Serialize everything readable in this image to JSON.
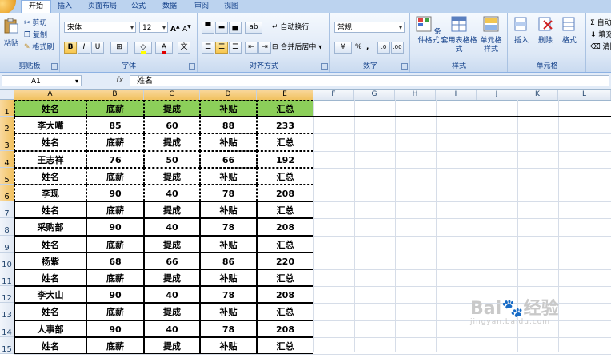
{
  "ribbon": {
    "tabs": [
      "开始",
      "插入",
      "页面布局",
      "公式",
      "数据",
      "审阅",
      "视图"
    ],
    "active_tab": "开始",
    "clipboard": {
      "paste": "粘贴",
      "cut": "剪切",
      "copy": "复制",
      "format_painter": "格式刷",
      "label": "剪贴板"
    },
    "font": {
      "name": "宋体",
      "size": "12",
      "bold": "B",
      "italic": "I",
      "underline": "U",
      "color_glyph": "A",
      "label": "字体"
    },
    "alignment": {
      "wrap": "自动换行",
      "merge": "合并后居中",
      "label": "对齐方式"
    },
    "number": {
      "format": "常规",
      "percent": "%",
      "comma": ",",
      "label": "数字"
    },
    "styles": {
      "conditional": "条件格式",
      "table_format": "套用表格格式",
      "cell_styles": "单元格样式",
      "label": "样式"
    },
    "cells": {
      "insert": "插入",
      "delete": "删除",
      "format": "格式",
      "label": "单元格"
    },
    "editing": {
      "autosum": "自动",
      "fill": "填充",
      "clear": "清除"
    },
    "colors": {
      "accent": "#15428b",
      "bold_active": "#f7c64d"
    }
  },
  "formula_bar": {
    "name_box": "A1",
    "fx": "fx",
    "content": "姓名"
  },
  "columns": [
    "A",
    "B",
    "C",
    "D",
    "E",
    "F",
    "G",
    "H",
    "I",
    "J",
    "K",
    "L"
  ],
  "rows": [
    {
      "num": "1",
      "cells": [
        "姓名",
        "底薪",
        "提成",
        "补贴",
        "汇总"
      ],
      "header": true
    },
    {
      "num": "2",
      "cells": [
        "李大嘴",
        "85",
        "60",
        "88",
        "233"
      ]
    },
    {
      "num": "3",
      "cells": [
        "姓名",
        "底薪",
        "提成",
        "补贴",
        "汇总"
      ]
    },
    {
      "num": "4",
      "cells": [
        "王志祥",
        "76",
        "50",
        "66",
        "192"
      ]
    },
    {
      "num": "5",
      "cells": [
        "姓名",
        "底薪",
        "提成",
        "补贴",
        "汇总"
      ]
    },
    {
      "num": "6",
      "cells": [
        "李现",
        "90",
        "40",
        "78",
        "208"
      ]
    },
    {
      "num": "7",
      "cells": [
        "姓名",
        "底薪",
        "提成",
        "补贴",
        "汇总"
      ]
    },
    {
      "num": "8",
      "cells": [
        "采购部",
        "90",
        "40",
        "78",
        "208"
      ]
    },
    {
      "num": "9",
      "cells": [
        "姓名",
        "底薪",
        "提成",
        "补贴",
        "汇总"
      ]
    },
    {
      "num": "10",
      "cells": [
        "杨紫",
        "68",
        "66",
        "86",
        "220"
      ]
    },
    {
      "num": "11",
      "cells": [
        "姓名",
        "底薪",
        "提成",
        "补贴",
        "汇总"
      ]
    },
    {
      "num": "12",
      "cells": [
        "李大山",
        "90",
        "40",
        "78",
        "208"
      ]
    },
    {
      "num": "13",
      "cells": [
        "姓名",
        "底薪",
        "提成",
        "补贴",
        "汇总"
      ]
    },
    {
      "num": "14",
      "cells": [
        "人事部",
        "90",
        "40",
        "78",
        "208"
      ]
    },
    {
      "num": "15",
      "cells": [
        "姓名",
        "底薪",
        "提成",
        "补贴",
        "汇总"
      ]
    }
  ],
  "header_fill": "#8ccf5a",
  "watermark": {
    "brand": "Bai",
    "brand2": "经验",
    "url": "jingyan.baidu.com"
  }
}
